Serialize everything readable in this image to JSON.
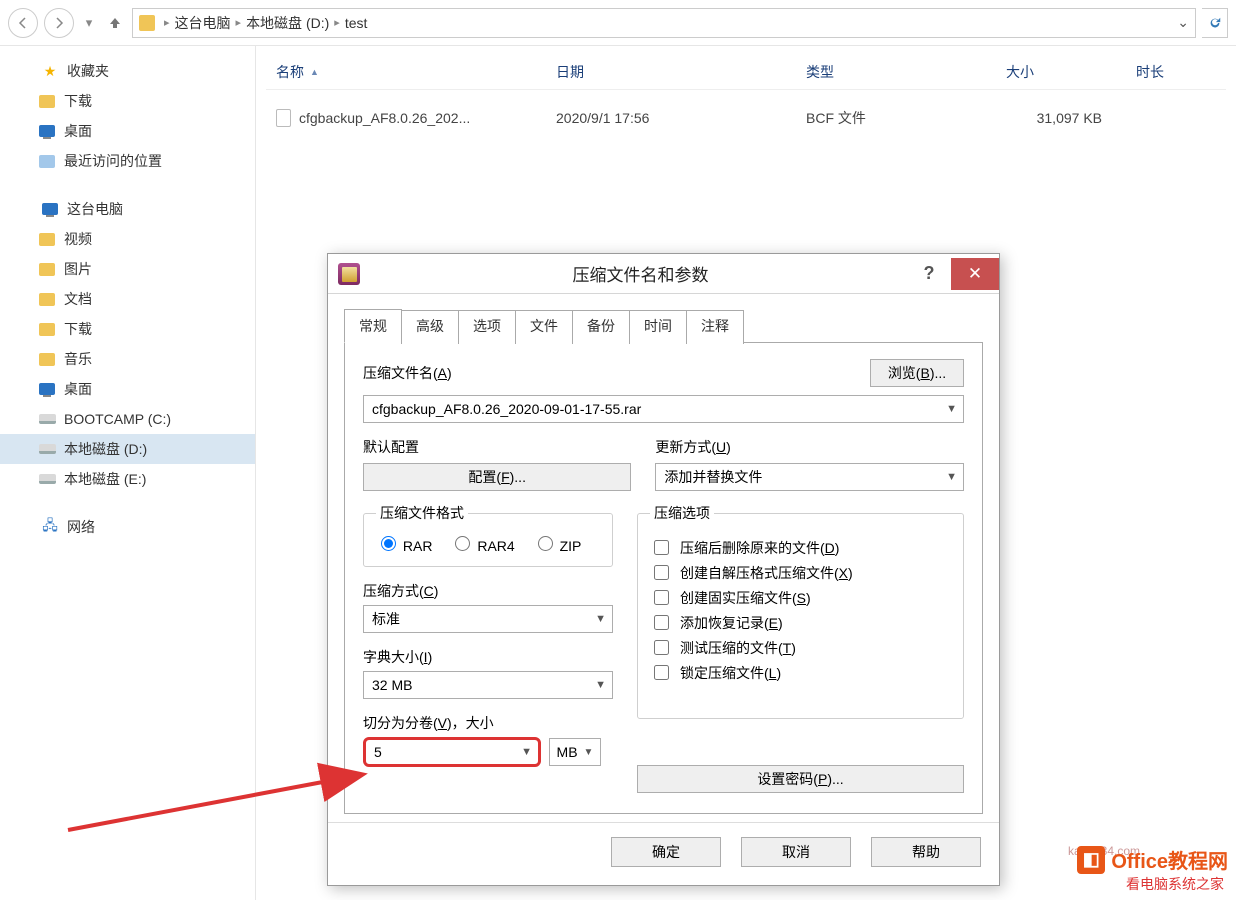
{
  "breadcrumb": [
    "这台电脑",
    "本地磁盘 (D:)",
    "test"
  ],
  "columns": {
    "name": "名称",
    "date": "日期",
    "type": "类型",
    "size": "大小",
    "length": "时长"
  },
  "file": {
    "name": "cfgbackup_AF8.0.26_202...",
    "date": "2020/9/1 17:56",
    "type": "BCF 文件",
    "size": "31,097 KB"
  },
  "sidebar": {
    "fav": "收藏夹",
    "fav_items": [
      "下载",
      "桌面",
      "最近访问的位置"
    ],
    "pc": "这台电脑",
    "pc_items": [
      "视频",
      "图片",
      "文档",
      "下载",
      "音乐",
      "桌面",
      "BOOTCAMP (C:)",
      "本地磁盘 (D:)",
      "本地磁盘 (E:)"
    ],
    "pc_selected_index": 7,
    "net": "网络"
  },
  "dialog": {
    "title": "压缩文件名和参数",
    "tabs": [
      "常规",
      "高级",
      "选项",
      "文件",
      "备份",
      "时间",
      "注释"
    ],
    "active_tab": 0,
    "archive_name_label": "压缩文件名(A)",
    "browse": "浏览(B)...",
    "archive_name": "cfgbackup_AF8.0.26_2020-09-01-17-55.rar",
    "profile_label": "默认配置",
    "profile_btn": "配置(F)...",
    "update_label": "更新方式(U)",
    "update_value": "添加并替换文件",
    "format_label": "压缩文件格式",
    "formats": [
      "RAR",
      "RAR4",
      "ZIP"
    ],
    "format_selected": 0,
    "method_label": "压缩方式(C)",
    "method_value": "标准",
    "dict_label": "字典大小(I)",
    "dict_value": "32 MB",
    "split_label": "切分为分卷(V)，大小",
    "split_value": "5",
    "split_unit": "MB",
    "options_label": "压缩选项",
    "options": [
      "压缩后删除原来的文件(D)",
      "创建自解压格式压缩文件(X)",
      "创建固实压缩文件(S)",
      "添加恢复记录(E)",
      "测试压缩的文件(T)",
      "锁定压缩文件(L)"
    ],
    "password_btn": "设置密码(P)...",
    "ok": "确定",
    "cancel": "取消",
    "help": "帮助"
  },
  "watermarks": {
    "w1": "Office教程网",
    "w2": "看电脑系统之家",
    "w3": "kan1234.com"
  }
}
